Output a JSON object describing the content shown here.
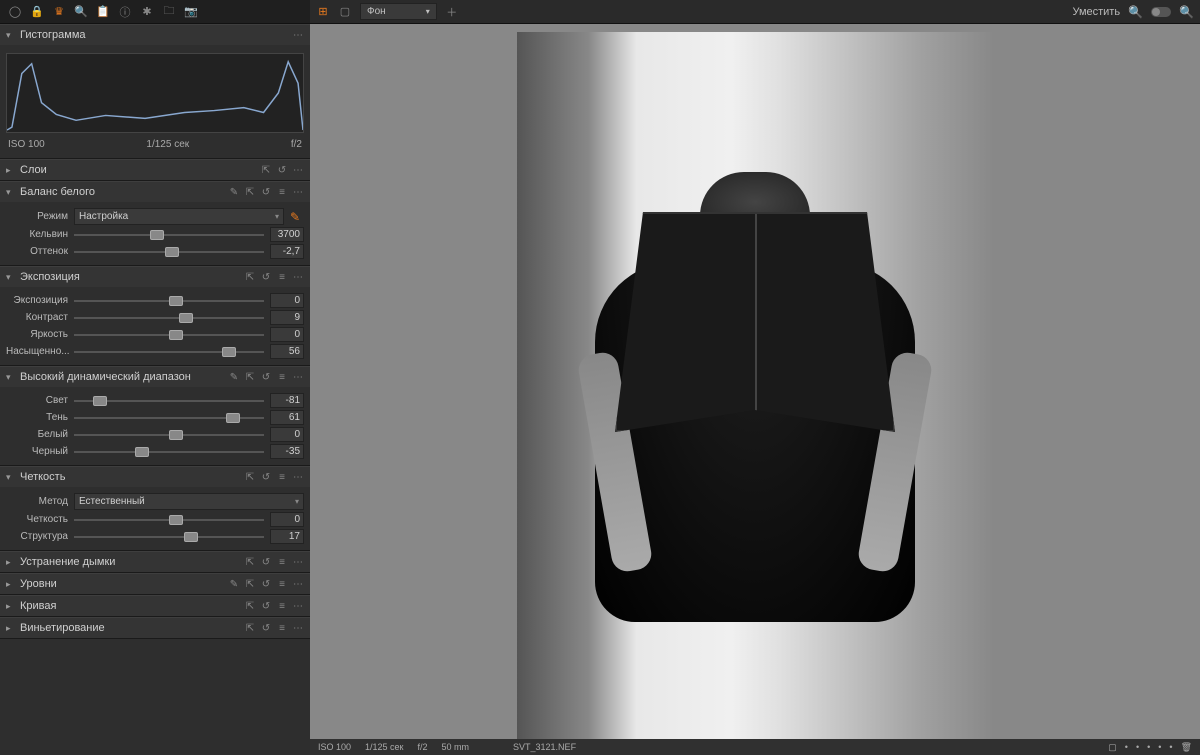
{
  "sidebar": {
    "toolbar_icons": [
      "circle",
      "lock",
      "crown",
      "search",
      "clipboard",
      "info",
      "gear",
      "folder",
      "camera"
    ],
    "panels": {
      "histogram": {
        "title": "Гистограмма",
        "iso": "ISO 100",
        "shutter": "1/125 сек",
        "aperture": "f/2"
      },
      "layers": {
        "title": "Слои"
      },
      "wb": {
        "title": "Баланс белого",
        "mode_label": "Режим",
        "mode_value": "Настройка",
        "kelvin_label": "Кельвин",
        "kelvin_value": "3700",
        "tint_label": "Оттенок",
        "tint_value": "-2,7"
      },
      "exposure": {
        "title": "Экспозиция",
        "rows": [
          {
            "label": "Экспозиция",
            "value": "0",
            "pos": 50
          },
          {
            "label": "Контраст",
            "value": "9",
            "pos": 55
          },
          {
            "label": "Яркость",
            "value": "0",
            "pos": 50
          },
          {
            "label": "Насыщенно...",
            "value": "56",
            "pos": 78
          }
        ]
      },
      "hdr": {
        "title": "Высокий динамический диапазон",
        "rows": [
          {
            "label": "Свет",
            "value": "-81",
            "pos": 10
          },
          {
            "label": "Тень",
            "value": "61",
            "pos": 80
          },
          {
            "label": "Белый",
            "value": "0",
            "pos": 50
          },
          {
            "label": "Черный",
            "value": "-35",
            "pos": 32
          }
        ]
      },
      "clarity": {
        "title": "Четкость",
        "method_label": "Метод",
        "method_value": "Естественный",
        "rows": [
          {
            "label": "Четкость",
            "value": "0",
            "pos": 50
          },
          {
            "label": "Структура",
            "value": "17",
            "pos": 58
          }
        ]
      },
      "dehaze": {
        "title": "Устранение дымки"
      },
      "levels": {
        "title": "Уровни"
      },
      "curve": {
        "title": "Кривая"
      },
      "vignette": {
        "title": "Виньетирование"
      }
    }
  },
  "main": {
    "layer_select": "Фон",
    "fit_label": "Уместить",
    "status": {
      "iso": "ISO 100",
      "shutter": "1/125 сек",
      "aperture": "f/2",
      "focal": "50 mm",
      "filename": "SVT_3121.NEF"
    }
  }
}
